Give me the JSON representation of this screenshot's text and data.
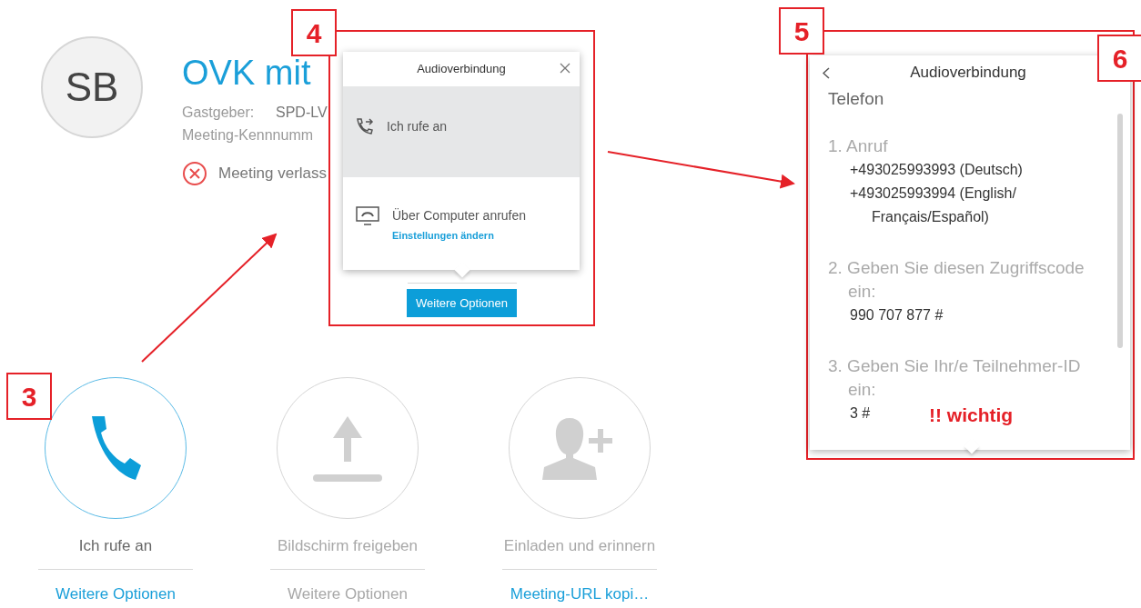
{
  "meeting": {
    "avatar": "SB",
    "title": "OVK mit",
    "host_label": "Gastgeber:",
    "host": "SPD-LV",
    "meeting_number_label": "Meeting-Kennnumm",
    "leave": "Meeting verlass"
  },
  "actions": [
    {
      "kind": "phone",
      "label": "Ich rufe an",
      "link": "Weitere Optionen",
      "active": true,
      "link_disabled": false
    },
    {
      "kind": "share",
      "label": "Bildschirm freigeben",
      "link": "Weitere Optionen",
      "active": false,
      "link_disabled": true
    },
    {
      "kind": "invite",
      "label": "Einladen und erinnern",
      "link": "Meeting-URL kopi…",
      "active": false,
      "link_disabled": false
    }
  ],
  "audio_popup": {
    "title": "Audioverbindung",
    "options": [
      {
        "kind": "phone",
        "label": "Ich rufe an",
        "selected": true
      },
      {
        "kind": "computer",
        "label": "Über Computer anrufen",
        "link": "Einstellungen ändern",
        "selected": false
      }
    ],
    "button": "Weitere Optionen"
  },
  "phone_popup": {
    "title": "Audioverbindung",
    "section": "Telefon",
    "steps": [
      {
        "label": "1. Anruf",
        "values": [
          "+493025993993 (Deutsch)",
          "+493025993994 (English/ Français/Español)"
        ]
      },
      {
        "label": "2. Geben Sie diesen Zugriffscode ein:",
        "values": [
          "990 707 877 #"
        ]
      },
      {
        "label": "3. Geben Sie Ihr/e Teilnehmer-ID ein:",
        "values": [
          "3 #"
        ]
      }
    ]
  },
  "annotations": {
    "callouts": [
      "3",
      "4",
      "5",
      "6"
    ],
    "note": "!! wichtig"
  }
}
